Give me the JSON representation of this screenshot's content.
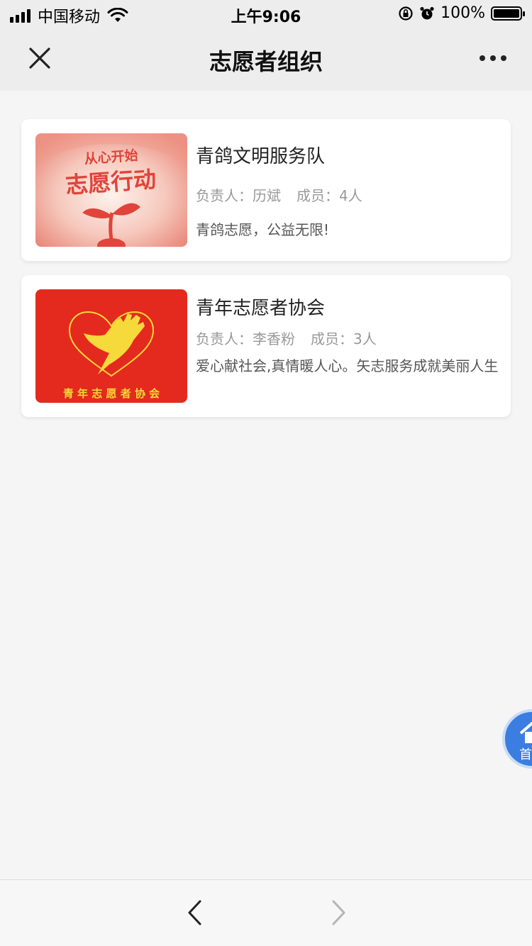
{
  "status_bar": {
    "carrier": "中国移动",
    "time": "上午9:06",
    "battery": "100%",
    "battery_level": 1.0,
    "icons": [
      "signal-icon",
      "wifi-icon",
      "rotation-lock-icon",
      "alarm-icon",
      "battery-icon"
    ]
  },
  "nav": {
    "title": "志愿者组织",
    "close_icon": "close-icon",
    "more_icon": "more-icon"
  },
  "organizations": [
    {
      "name": "青鸽文明服务队",
      "leader_label": "负责人：",
      "leader": "历斌",
      "members_label": "成员：",
      "members": "4人",
      "description": "青鸽志愿，公益无限!",
      "image_text_top": "从心开始",
      "image_text_main": "志愿行动",
      "image_colors": {
        "background": "#f2b5a8",
        "text": "#e0443a",
        "sprout": "#e0443a"
      }
    },
    {
      "name": "青年志愿者协会",
      "leader_label": "负责人：",
      "leader": "李香粉",
      "members_label": "成员：",
      "members": "3人",
      "description": "爱心献社会,真情暖人心。矢志服务成就美丽人生",
      "image_text_bottom": "青 年 志 愿 者 协 会",
      "image_colors": {
        "background": "#e42a1e",
        "emblem": "#f6d93a"
      }
    }
  ],
  "fab": {
    "label": "首",
    "icon": "home-icon",
    "color": "#3b7de0"
  },
  "toolbar": {
    "back_icon": "chevron-left-icon",
    "forward_icon": "chevron-right-icon"
  }
}
